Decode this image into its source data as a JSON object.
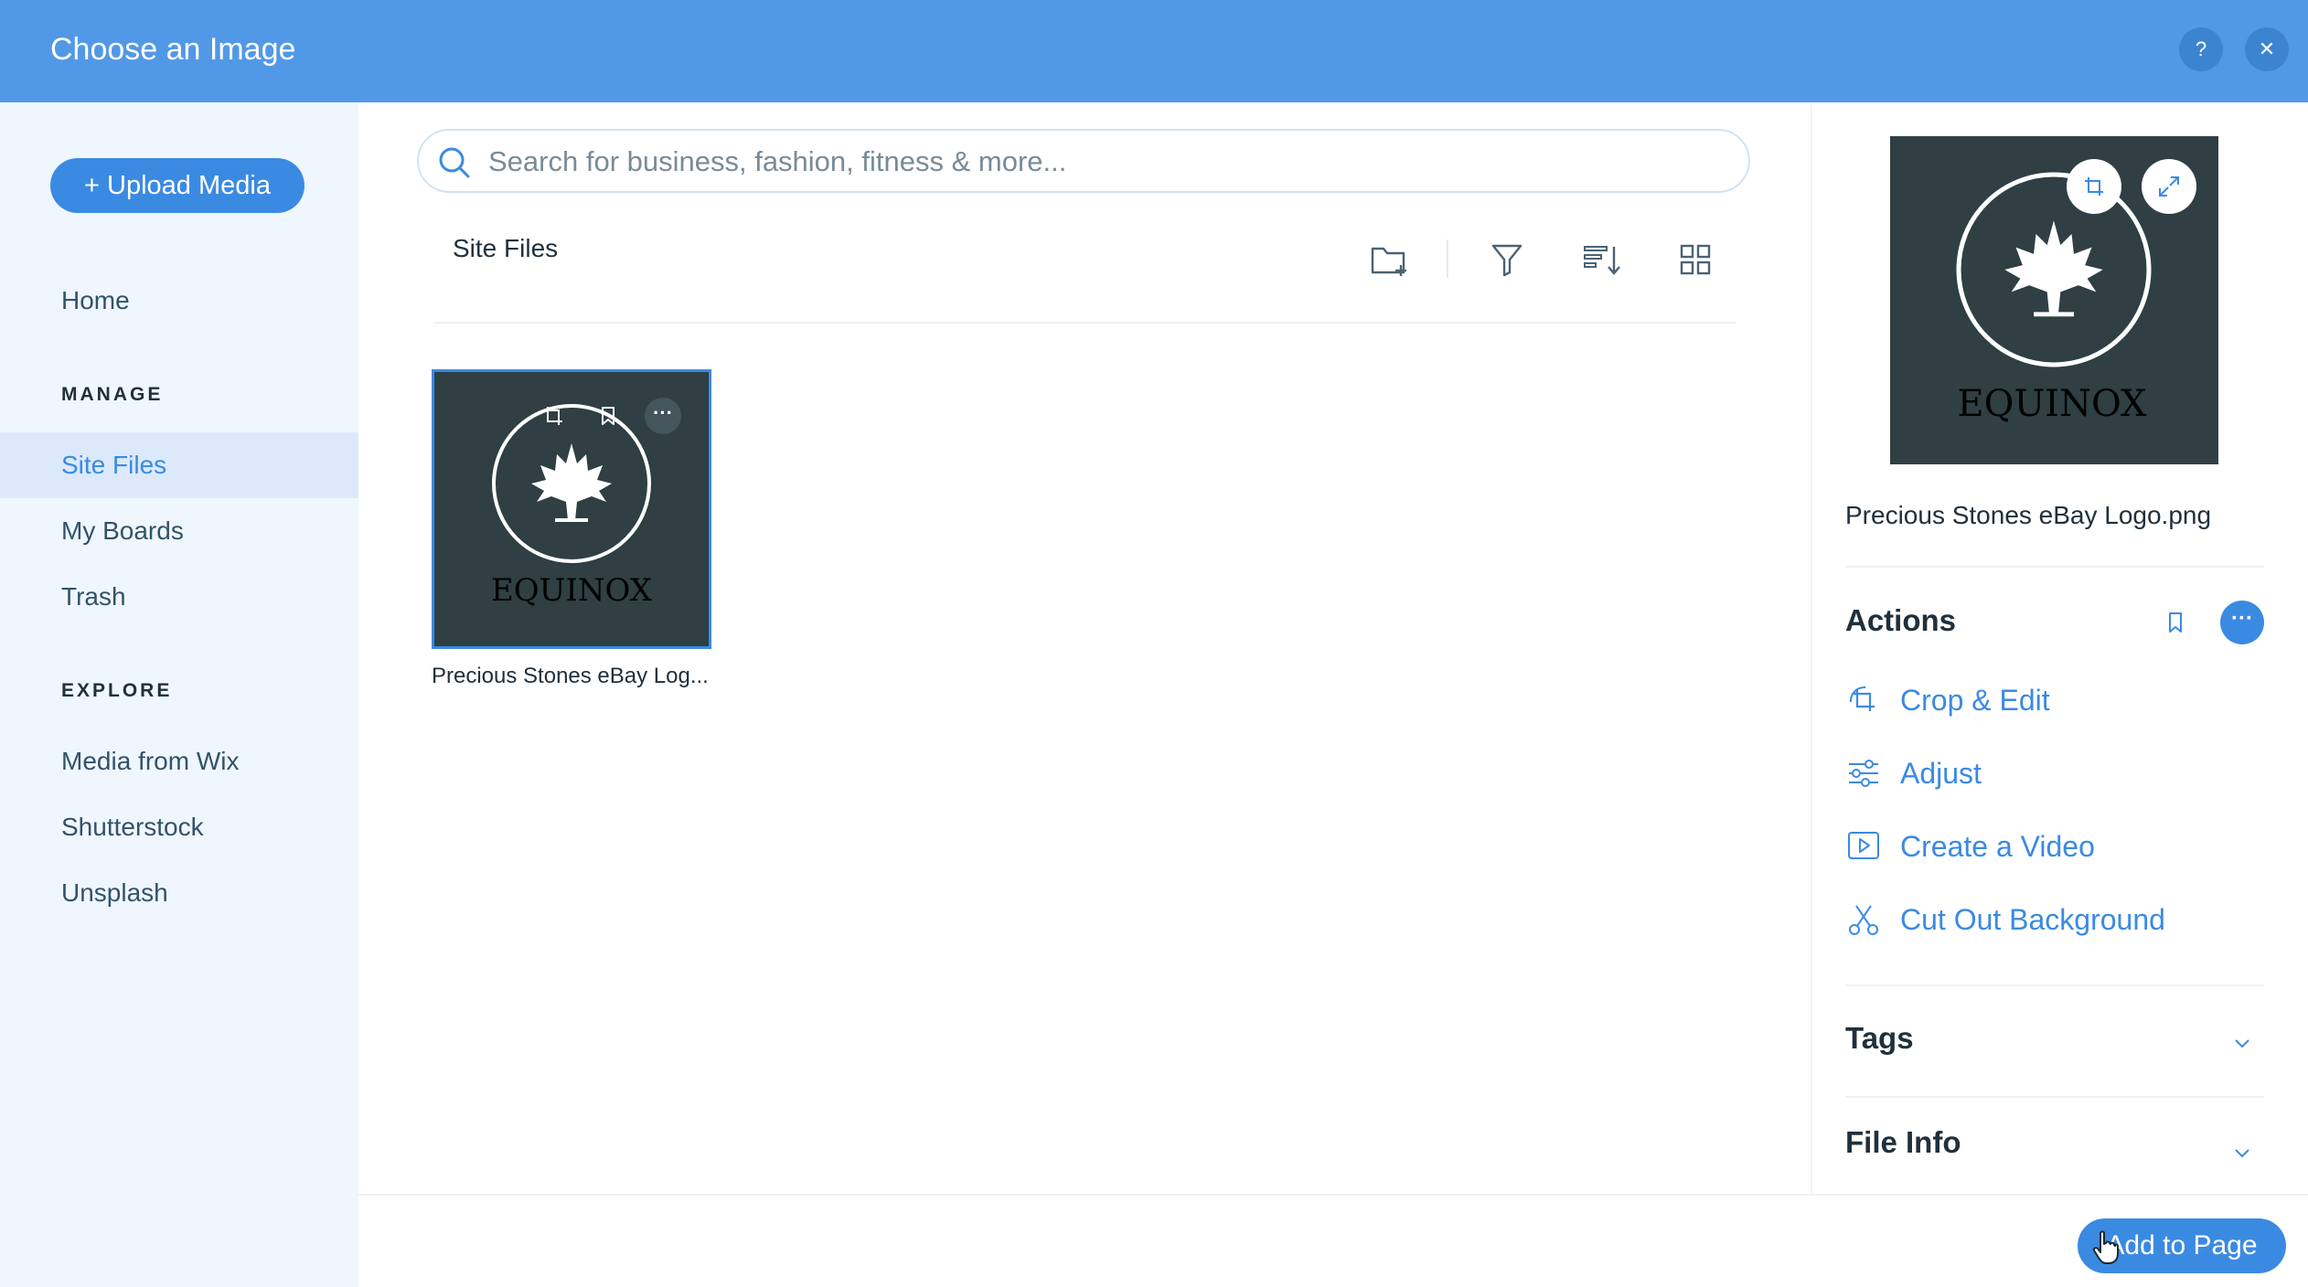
{
  "header": {
    "title": "Choose an Image",
    "help_label": "?",
    "close_label": "✕"
  },
  "sidebar": {
    "upload_label": "+ Upload Media",
    "home_label": "Home",
    "manage_heading": "MANAGE",
    "manage_items": [
      {
        "label": "Site Files",
        "active": true
      },
      {
        "label": "My Boards"
      },
      {
        "label": "Trash"
      }
    ],
    "explore_heading": "EXPLORE",
    "explore_items": [
      {
        "label": "Media from Wix"
      },
      {
        "label": "Shutterstock"
      },
      {
        "label": "Unsplash"
      }
    ]
  },
  "search": {
    "placeholder": "Search for business, fashion, fitness & more...",
    "value": ""
  },
  "content": {
    "folder_title": "Site Files",
    "toolbar_icons": [
      "new-folder-icon",
      "filter-icon",
      "sort-icon",
      "grid-view-icon"
    ],
    "files": [
      {
        "name": "Precious Stones eBay Log...",
        "logo_text": "EQUINOX",
        "selected": true
      }
    ]
  },
  "details": {
    "logo_text": "EQUINOX",
    "filename": "Precious Stones eBay Logo.png",
    "actions_title": "Actions",
    "actions": [
      {
        "label": "Crop & Edit",
        "icon": "crop-icon"
      },
      {
        "label": "Adjust",
        "icon": "adjust-sliders-icon"
      },
      {
        "label": "Create a Video",
        "icon": "video-icon"
      },
      {
        "label": "Cut Out Background",
        "icon": "scissors-icon"
      }
    ],
    "tags_title": "Tags",
    "file_info_title": "File Info"
  },
  "footer": {
    "add_label": "Add to Page"
  },
  "colors": {
    "header": "#5199e6",
    "accent": "#3b8ae2",
    "sidebar_bg": "#f0f6fe",
    "active_bg": "#dbe9fb",
    "logo_bg": "#2f3f43"
  }
}
